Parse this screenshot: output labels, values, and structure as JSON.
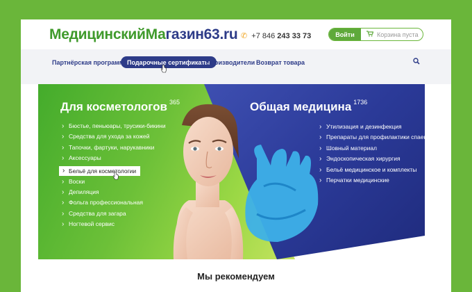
{
  "header": {
    "logo_part1": "МедицинскийМа",
    "logo_part2": "газин63.ru",
    "phone_prefix": "+7 846",
    "phone_number": "243 33 73",
    "login_label": "Войти",
    "cart_label": "Корзина пуста"
  },
  "nav": {
    "items": [
      {
        "label": "Партнёрская программа"
      },
      {
        "label": "Подарочные сертификаты"
      },
      {
        "label": "Производители"
      },
      {
        "label": "Возврат товара"
      }
    ]
  },
  "hero": {
    "left": {
      "title": "Для косметологов",
      "count": "365",
      "items": [
        "Бюстье, пеньюары, трусики-бикини",
        "Средства для ухода за кожей",
        "Тапочки, фартуки, нарукавники",
        "Аксессуары",
        "Бельё для косметологии",
        "Воски",
        "Депиляция",
        "Фольга профессиональная",
        "Средства для загара",
        "Ногтевой сервис"
      ]
    },
    "right": {
      "title": "Общая медицина",
      "count": "1736",
      "items": [
        "Утилизация и дезинфекция",
        "Препараты для профилактики спаек",
        "Шовный материал",
        "Эндоскопическая хирургия",
        "Бельё медицинское и комплекты",
        "Перчатки медицинские"
      ]
    }
  },
  "recommend": {
    "title": "Мы рекомендуем"
  },
  "icons": {
    "phone": "phone-icon",
    "cart": "cart-icon",
    "search": "search-icon",
    "cursor": "hand-cursor-icon"
  },
  "colors": {
    "background": "#6ab63a",
    "brand_green": "#3f9a2b",
    "brand_blue": "#2d3b88",
    "login_button": "#5ea93a",
    "phone_icon": "#f0a21b"
  }
}
